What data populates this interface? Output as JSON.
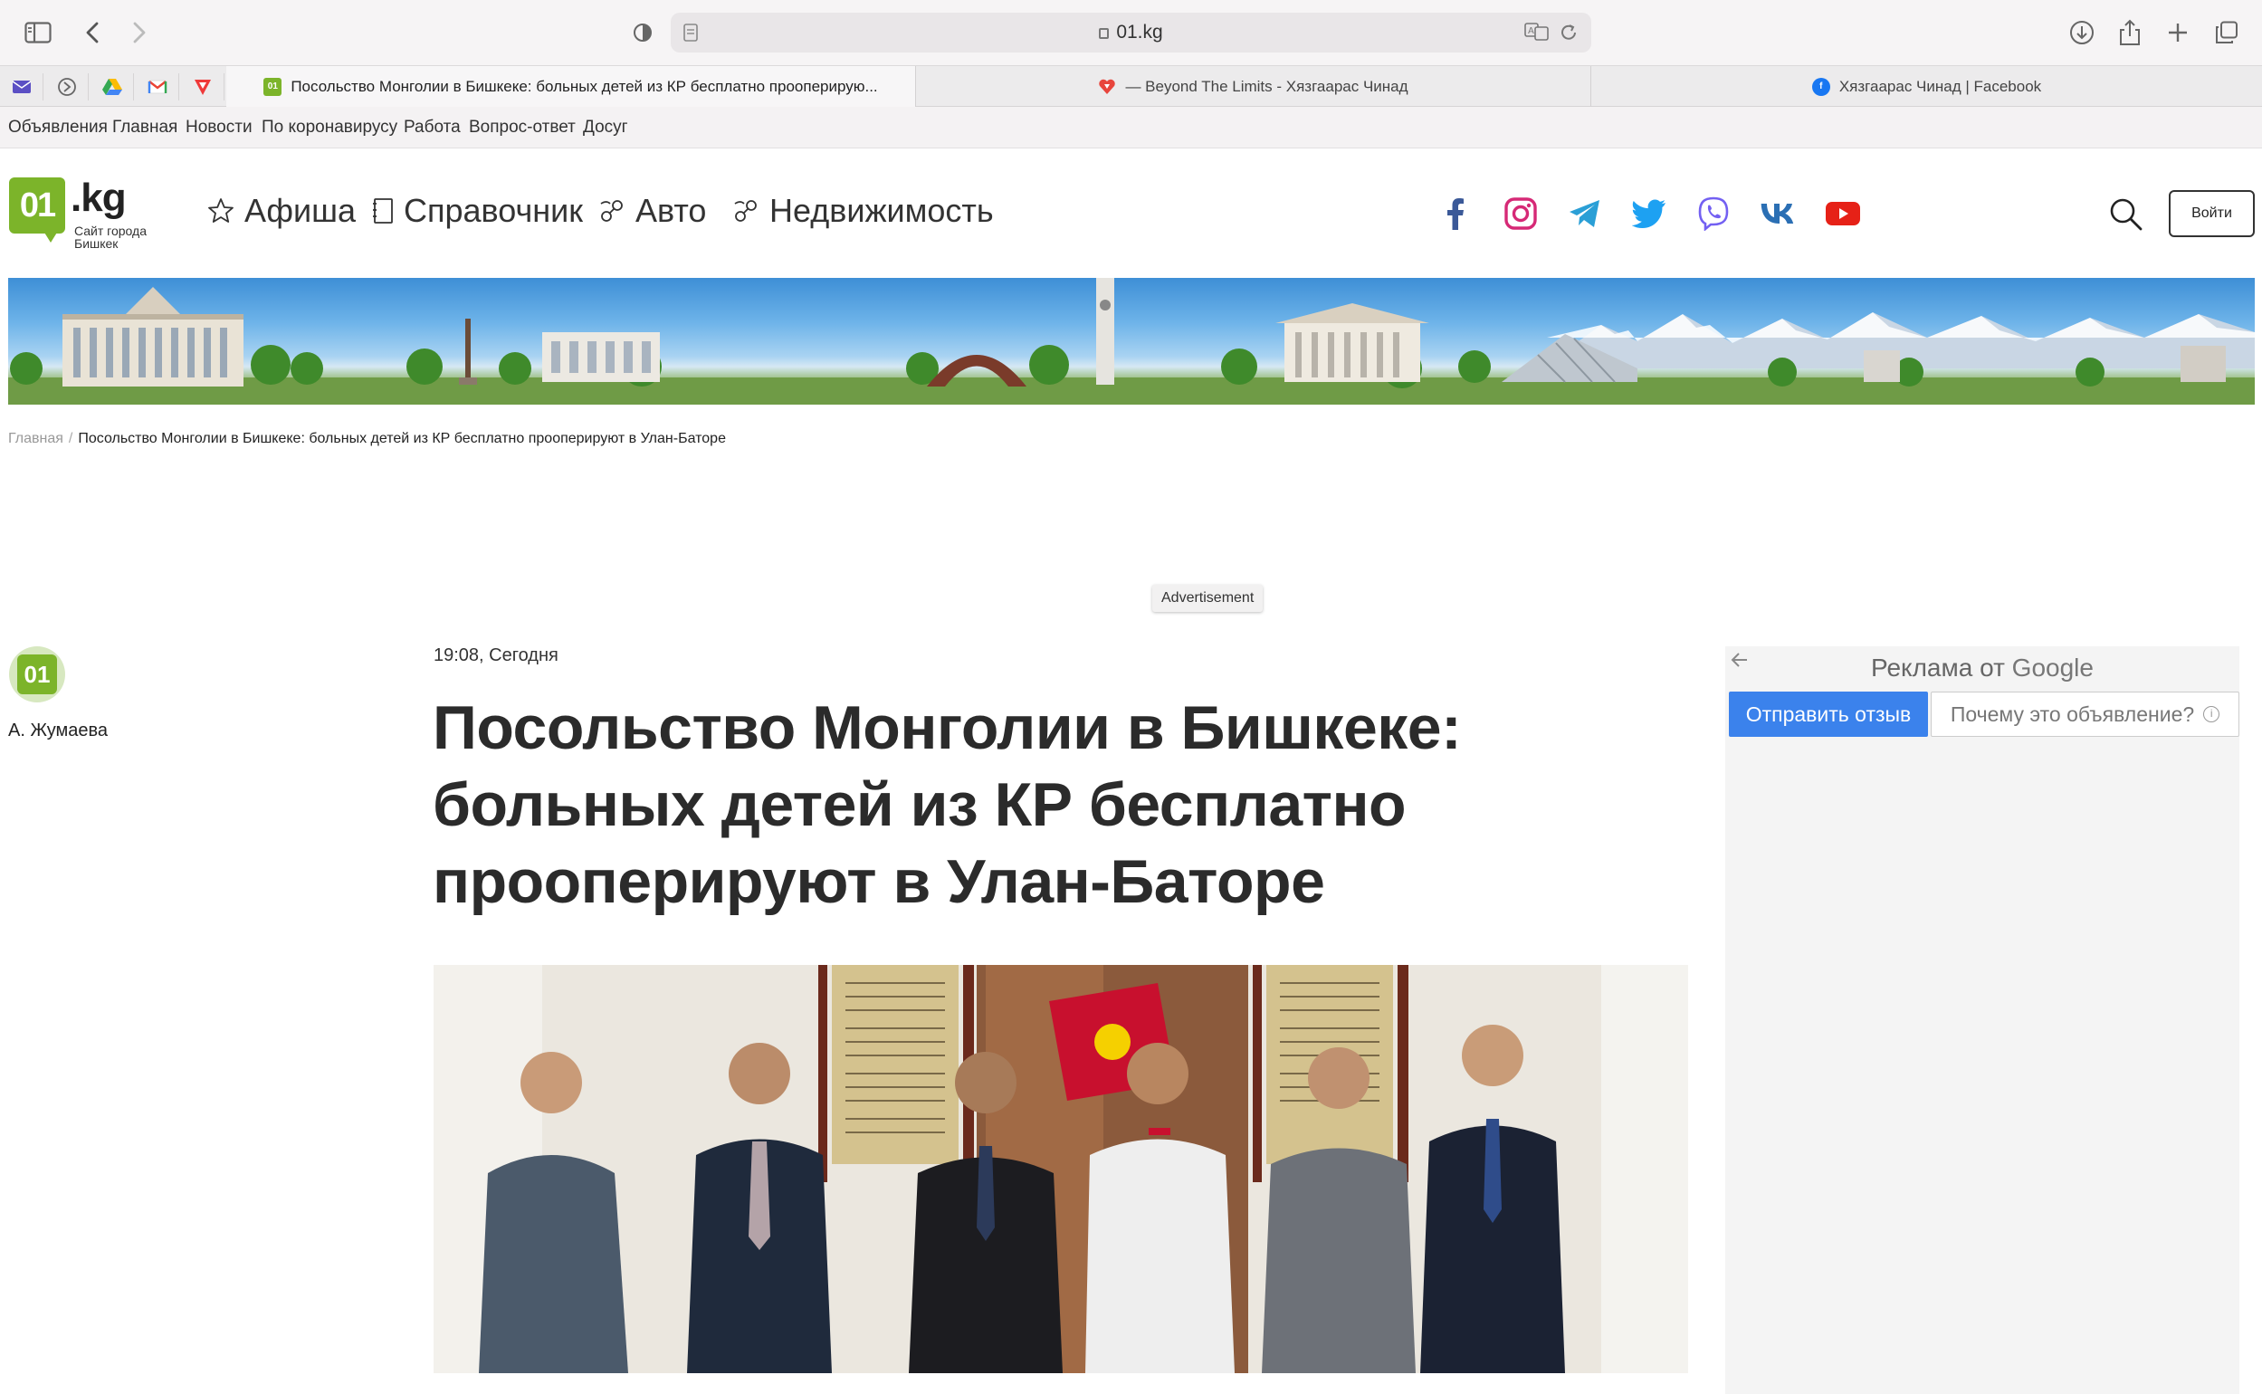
{
  "browser": {
    "url": "01.kg",
    "tabs": [
      {
        "label": "Посольство Монголии в Бишкеке: больных детей из КР бесплатно прооперирую...",
        "active": true
      },
      {
        "label": "— Beyond The Limits - Хязгаарaс Чинад",
        "active": false
      },
      {
        "label": "Хязгаарaс Чинад | Facebook",
        "active": false
      }
    ],
    "pinned_tabs": [
      "mail-icon",
      "circle-arrow-icon",
      "drive-icon",
      "gmail-icon",
      "vivaldi-icon"
    ],
    "favicon_01": "01"
  },
  "bookmarks": [
    "Объявления",
    "Главная",
    "Новости",
    "По коронавирусу",
    "Работа",
    "Вопрос-ответ",
    "Досуг"
  ],
  "site": {
    "logo_main": "01",
    "logo_kg": ".kg",
    "logo_sub1": "Сайт города",
    "logo_sub2": "Бишкек",
    "nav": [
      "Афиша",
      "Справочник",
      "Авто",
      "Недвижимость"
    ],
    "social": [
      "facebook-icon",
      "instagram-icon",
      "telegram-icon",
      "twitter-icon",
      "viber-icon",
      "vk-icon",
      "youtube-icon"
    ],
    "login_label": "Войти",
    "accent_color": "#7cb42a"
  },
  "breadcrumb": {
    "home": "Главная",
    "separator": "/",
    "current": "Посольство Монголии в Бишкеке: больных детей из КР бесплатно прооперируют в Улан-Баторе"
  },
  "advertisement_label": "Advertisement",
  "author": {
    "avatar_text": "01",
    "name": "А. Жумаева"
  },
  "article": {
    "date": "19:08, Сегодня",
    "title": "Посольство Монголии в Бишкеке: больных детей из КР бесплатно прооперируют в Улан-Баторе"
  },
  "google_ad": {
    "title_prefix": "Реклама от",
    "title_brand": "Google",
    "send_feedback": "Отправить отзыв",
    "why_this_ad": "Почему это объявление?",
    "info_glyph": "i"
  }
}
